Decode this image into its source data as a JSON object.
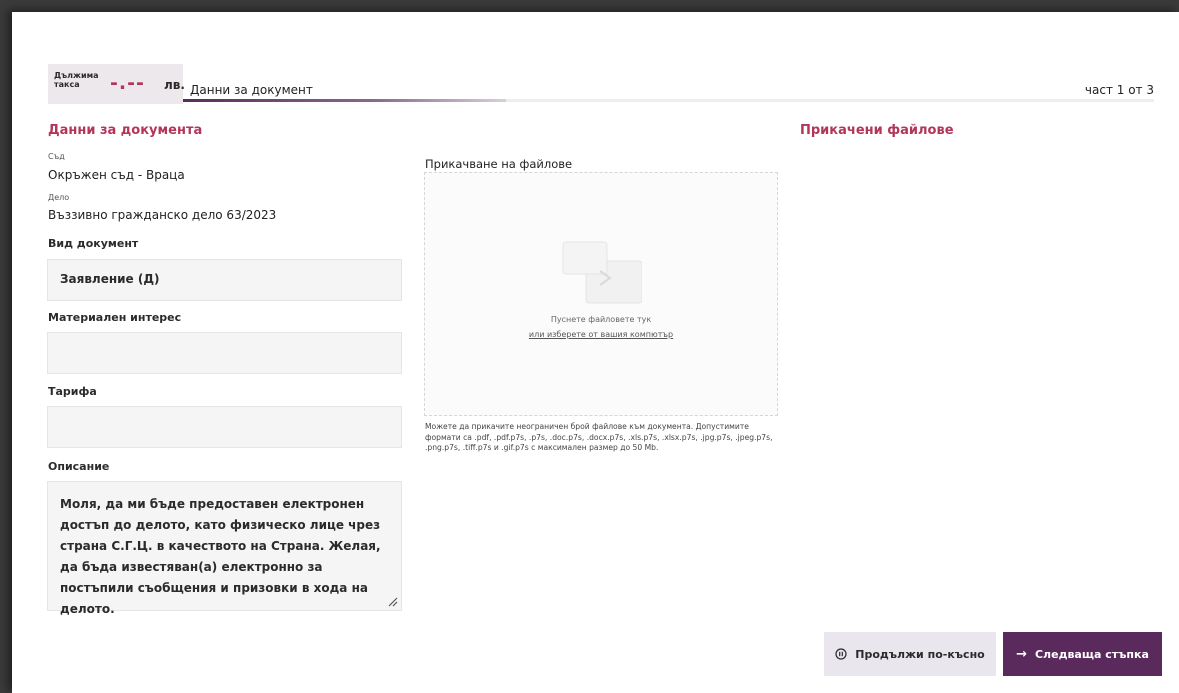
{
  "header": {
    "fee_label": "Дължима такса",
    "fee_amount": "-.--",
    "fee_currency": "лв.",
    "step_title": "Данни за документ",
    "step_count": "част 1 от 3",
    "progress": 0.333
  },
  "document": {
    "heading": "Данни за документа",
    "court_label": "Съд",
    "court_value": "Окръжен съд - Враца",
    "case_label": "Дело",
    "case_value": "Въззивно гражданско дело 63/2023",
    "doc_type_label": "Вид документ",
    "doc_type_value": "Заявление (Д)",
    "material_interest_label": "Материален интерес",
    "material_interest_value": "",
    "tariff_label": "Тарифа",
    "tariff_value": "",
    "description_label": "Описание",
    "description_value": "Моля, да ми бъде предоставен електронен достъп до делото, като физическо лице чрез страна С.Г.Ц. в качеството на Страна. Желая, да бъда известяван(а) електронно за постъпили съобщения и призовки в хода на делото."
  },
  "upload": {
    "title": "Прикачване на файлове",
    "drop_text": "Пуснете файловете тук",
    "drop_link": "или изберете от вашия компютър",
    "hint": "Можете да прикачите неограничен брой файлове към документа. Допустимите формати са .pdf, .pdf.p7s, .p7s, .doc.p7s, .docx.p7s, .xls.p7s, .xlsx.p7s, .jpg.p7s, .jpeg.p7s, .png.p7s, .tiff.p7s и .gif.p7s с максимален размер до 50 Mb."
  },
  "attached": {
    "heading": "Прикачени файлове"
  },
  "actions": {
    "later_label": "Продължи по-късно",
    "next_label": "Следваща стъпка"
  },
  "colors": {
    "accent": "#b2355a",
    "primary": "#5b2a5c",
    "secondary_button": "#e9e6ed"
  }
}
